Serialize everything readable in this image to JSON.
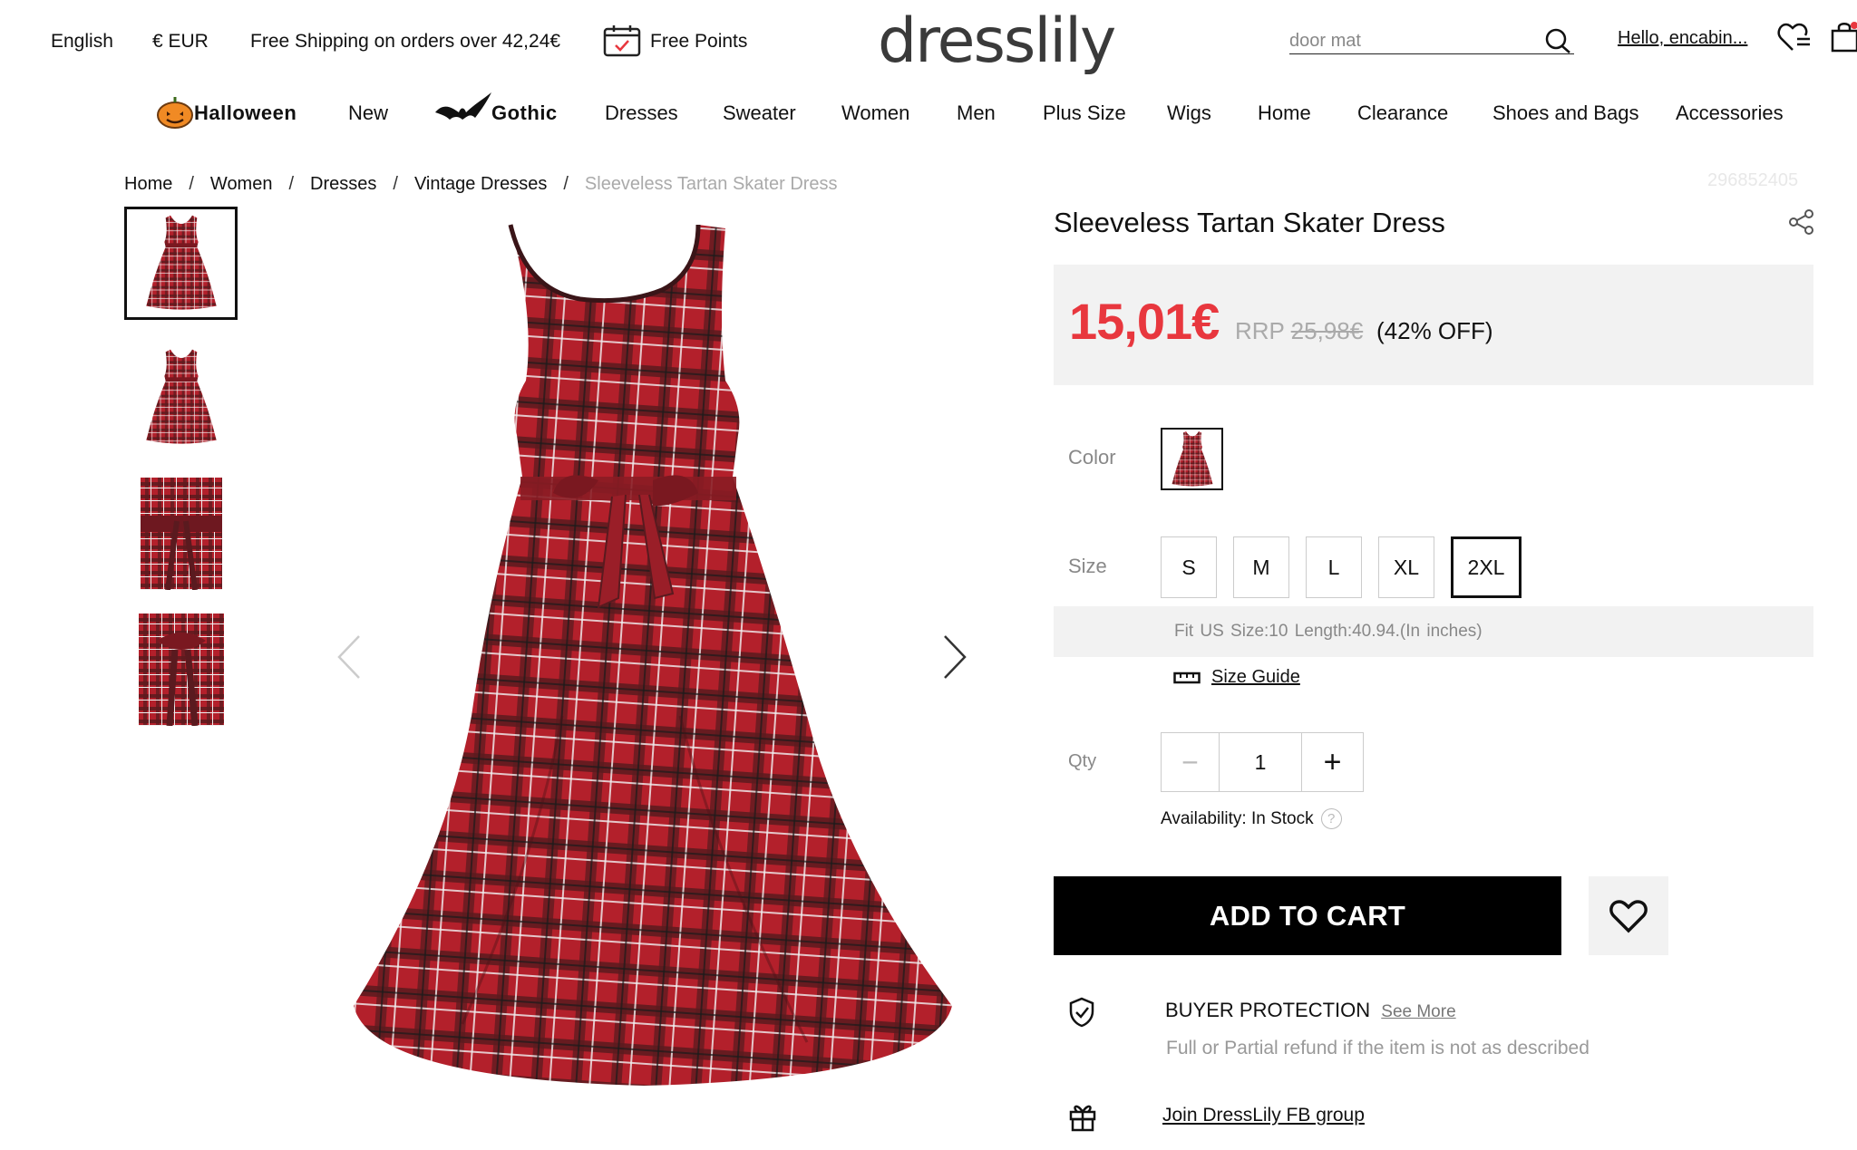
{
  "topbar": {
    "language": "English",
    "currency": "€ EUR",
    "shipping": "Free Shipping on orders over 42,24€",
    "points": "Free Points",
    "logo": "dresslily",
    "search_value": "door mat",
    "greeting": "Hello, encabin..."
  },
  "nav": {
    "items": [
      "Halloween",
      "New",
      "Gothic",
      "Dresses",
      "Sweater",
      "Women",
      "Men",
      "Plus Size",
      "Wigs",
      "Home",
      "Clearance",
      "Shoes and Bags",
      "Accessories"
    ]
  },
  "breadcrumb": [
    "Home",
    "Women",
    "Dresses",
    "Vintage Dresses",
    "Sleeveless Tartan Skater Dress"
  ],
  "breadcrumb_sep": "/",
  "product": {
    "sku": "296852405",
    "title": "Sleeveless Tartan Skater Dress",
    "price": "15,01€",
    "rrp_label": "RRP",
    "rrp_value": "25,98€",
    "discount": "(42% OFF)",
    "color_label": "Color",
    "size_label": "Size",
    "sizes": [
      "S",
      "M",
      "L",
      "XL",
      "2XL"
    ],
    "selected_size": "2XL",
    "fit_text": "Fit US Size:10   Length:40.94.(In inches)",
    "size_guide": "Size Guide",
    "qty_label": "Qty",
    "qty_minus": "−",
    "qty_value": "1",
    "qty_plus": "+",
    "availability": "Availability: In Stock",
    "availability_help": "?",
    "add_to_cart": "ADD TO CART"
  },
  "protection": {
    "title": "BUYER PROTECTION",
    "see_more": "See More",
    "description": "Full or Partial refund if the item is not as described",
    "fb_group": "Join DressLily FB group"
  },
  "colors": {
    "price_red": "#e8373e",
    "dress_red": "#b3202b",
    "dress_dark": "#3a1518",
    "panel_grey": "#f2f2f2"
  }
}
